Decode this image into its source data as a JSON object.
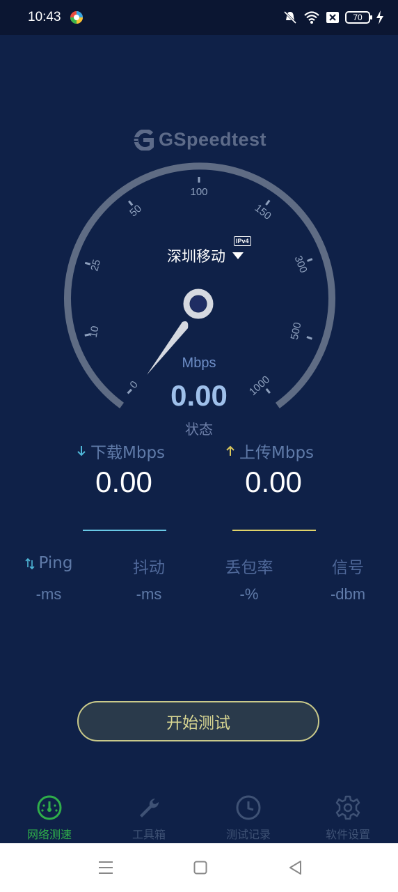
{
  "status_bar": {
    "time": "10:43",
    "battery": "70"
  },
  "app": {
    "logo": "GSpeedtest",
    "gauge_ticks": [
      "0",
      "10",
      "25",
      "50",
      "100",
      "150",
      "300",
      "500",
      "1000"
    ],
    "server": {
      "name": "深圳移动",
      "protocol_badge": "IPv4"
    },
    "unit": "Mbps",
    "speed": "0.00",
    "state": "状态",
    "download": {
      "label": "下载Mbps",
      "value": "0.00"
    },
    "upload": {
      "label": "上传Mbps",
      "value": "0.00"
    },
    "stats": [
      {
        "label": "Ping",
        "value": "-ms"
      },
      {
        "label": "抖动",
        "value": "-ms"
      },
      {
        "label": "丢包率",
        "value": "-%"
      },
      {
        "label": "信号",
        "value": "-dbm"
      }
    ],
    "start_button": "开始测试"
  },
  "bottom_nav": [
    {
      "label": "网络测速",
      "icon": "speedometer-icon",
      "active": true
    },
    {
      "label": "工具箱",
      "icon": "wrench-icon",
      "active": false
    },
    {
      "label": "测试记录",
      "icon": "clock-icon",
      "active": false
    },
    {
      "label": "软件设置",
      "icon": "gear-icon",
      "active": false
    }
  ],
  "colors": {
    "background": "#0f2148",
    "accent_green": "#2fae4a",
    "download_line": "#69c9e6",
    "upload_line": "#e0d36a",
    "speed_value": "#9fc0ea"
  }
}
